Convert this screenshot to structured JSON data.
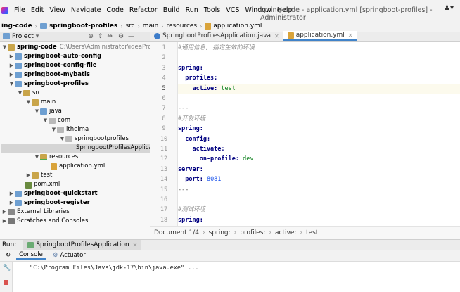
{
  "menubar": {
    "items": [
      {
        "mnemonic": "F",
        "rest": "ile"
      },
      {
        "mnemonic": "E",
        "rest": "dit"
      },
      {
        "mnemonic": "V",
        "rest": "iew"
      },
      {
        "mnemonic": "N",
        "rest": "avigate"
      },
      {
        "mnemonic": "C",
        "rest": "ode"
      },
      {
        "mnemonic": "R",
        "rest": "efactor"
      },
      {
        "mnemonic": "B",
        "rest": "uild"
      },
      {
        "mnemonic": "R",
        "rest": "un"
      },
      {
        "mnemonic": "T",
        "rest": "ools"
      },
      {
        "mnemonic": "V",
        "rest": "CS"
      },
      {
        "mnemonic": "W",
        "rest": "indow"
      },
      {
        "mnemonic": "H",
        "rest": "elp"
      }
    ],
    "window_title": "spring-code - application.yml [springboot-profiles] - Administrator"
  },
  "navbar": {
    "crumbs": [
      "ing-code",
      "springboot-profiles",
      "src",
      "main",
      "resources",
      "application.yml"
    ]
  },
  "project_panel": {
    "title": "Project",
    "tree": [
      {
        "label": "spring-code",
        "extra": "C:\\Users\\Administrator\\ideaProjects",
        "bold": true
      },
      {
        "label": "springboot-auto-config",
        "bold": true
      },
      {
        "label": "springboot-config-file",
        "bold": true
      },
      {
        "label": "springboot-mybatis",
        "bold": true
      },
      {
        "label": "springboot-profiles",
        "bold": true
      },
      {
        "label": "src"
      },
      {
        "label": "main"
      },
      {
        "label": "java"
      },
      {
        "label": "com"
      },
      {
        "label": "itheima"
      },
      {
        "label": "springbootprofiles"
      },
      {
        "label": "SpringbootProfilesApplication"
      },
      {
        "label": "resources"
      },
      {
        "label": "application.yml"
      },
      {
        "label": "test"
      },
      {
        "label": "pom.xml"
      },
      {
        "label": "springboot-quickstart",
        "bold": true
      },
      {
        "label": "springboot-register",
        "bold": true
      },
      {
        "label": "External Libraries"
      },
      {
        "label": "Scratches and Consoles"
      }
    ]
  },
  "editor": {
    "tabs": [
      {
        "label": "SpringbootProfilesApplication.java"
      },
      {
        "label": "application.yml"
      }
    ],
    "lines": [
      {
        "no": "1",
        "text": "#通用信息, 指定生效的环境"
      },
      {
        "no": "2",
        "text": ""
      },
      {
        "no": "3",
        "text": "spring:"
      },
      {
        "no": "4",
        "text": "  profiles:"
      },
      {
        "no": "5",
        "key": "    active:",
        "val": " test"
      },
      {
        "no": "6",
        "text": ""
      },
      {
        "no": "7",
        "text": "---"
      },
      {
        "no": "8",
        "text": "#开发环境"
      },
      {
        "no": "9",
        "text": "spring:"
      },
      {
        "no": "10",
        "text": "  config:"
      },
      {
        "no": "11",
        "text": "    activate:"
      },
      {
        "no": "12",
        "key": "      on-profile:",
        "val": " dev"
      },
      {
        "no": "13",
        "text": "server:"
      },
      {
        "no": "14",
        "key": "  port:",
        "val": " 8081"
      },
      {
        "no": "15",
        "text": "---"
      },
      {
        "no": "16",
        "text": ""
      },
      {
        "no": "17",
        "text": "#测试环境"
      },
      {
        "no": "18",
        "text": "spring:"
      }
    ],
    "breadcrumb": [
      "Document 1/4",
      "spring:",
      "profiles:",
      "active:",
      "test"
    ]
  },
  "run_panel": {
    "label": "Run:",
    "config": "SpringbootProfilesApplication",
    "tabs": [
      "Console",
      "Actuator"
    ],
    "console_line": "\"C:\\Program Files\\Java\\jdk-17\\bin\\java.exe\" ..."
  },
  "colors": {
    "accent": "#4083c9",
    "keyword": "#000080",
    "string": "#067d17",
    "number": "#1750eb",
    "comment": "#8c8c8c"
  }
}
